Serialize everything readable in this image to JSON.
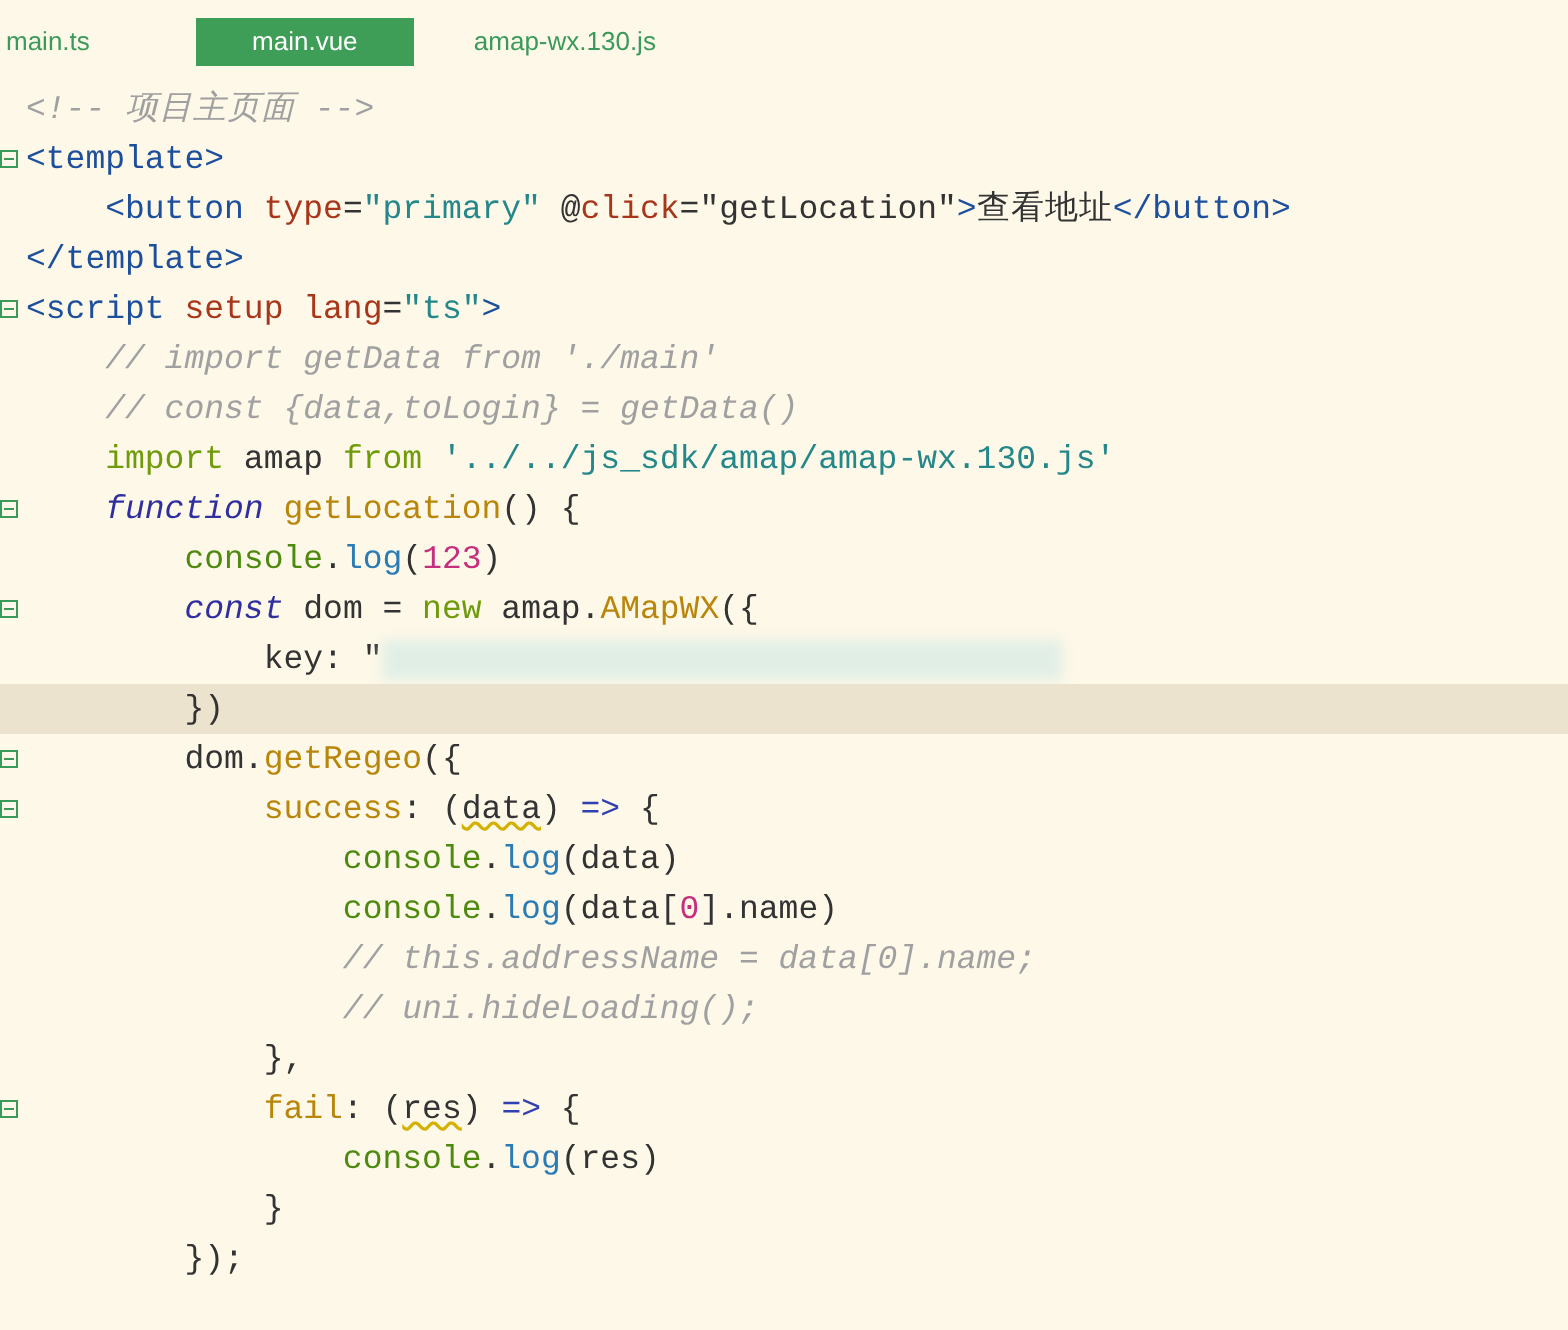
{
  "tabs": [
    {
      "label": "main.ts",
      "selected": false
    },
    {
      "label": "main.vue",
      "selected": true
    },
    {
      "label": "amap-wx.130.js",
      "selected": false
    }
  ],
  "editor": {
    "lines": [
      {
        "tokens": [
          {
            "kind": "comment",
            "text": "<!-- 项目主页面 -->"
          }
        ]
      },
      {
        "fold": true,
        "tokens": [
          {
            "kind": "tag",
            "text": "<template>"
          }
        ]
      },
      {
        "tokens": [
          {
            "kind": "tag",
            "text": "    <button "
          },
          {
            "kind": "attr",
            "text": "type"
          },
          {
            "kind": "plain",
            "text": "="
          },
          {
            "kind": "string",
            "text": "\"primary\""
          },
          {
            "kind": "plain",
            "text": " @"
          },
          {
            "kind": "attr",
            "text": "click"
          },
          {
            "kind": "plain",
            "text": "=\"getLocation\""
          },
          {
            "kind": "tag",
            "text": ">"
          },
          {
            "kind": "plain",
            "text": "查看地址"
          },
          {
            "kind": "tag",
            "text": "</button>"
          }
        ]
      },
      {
        "tokens": [
          {
            "kind": "tag",
            "text": "</template>"
          }
        ]
      },
      {
        "fold": true,
        "tokens": [
          {
            "kind": "tag",
            "text": "<script "
          },
          {
            "kind": "attr",
            "text": "setup lang"
          },
          {
            "kind": "plain",
            "text": "="
          },
          {
            "kind": "string",
            "text": "\"ts\""
          },
          {
            "kind": "tag",
            "text": ">"
          }
        ]
      },
      {
        "tokens": [
          {
            "kind": "comment",
            "text": "    // import getData from './main'"
          }
        ]
      },
      {
        "tokens": [
          {
            "kind": "comment",
            "text": "    // const {data,toLogin} = getData()"
          }
        ]
      },
      {
        "tokens": [
          {
            "kind": "keyword",
            "text": "    import"
          },
          {
            "kind": "plain",
            "text": " amap "
          },
          {
            "kind": "keyword",
            "text": "from "
          },
          {
            "kind": "string",
            "text": "'../../js_sdk/amap/amap-wx.130.js'"
          }
        ]
      },
      {
        "fold": true,
        "tokens": [
          {
            "kind": "storage",
            "text": "    function "
          },
          {
            "kind": "function",
            "text": "getLocation"
          },
          {
            "kind": "plain",
            "text": "() {"
          }
        ]
      },
      {
        "tokens": [
          {
            "kind": "object",
            "text": "        console"
          },
          {
            "kind": "plain",
            "text": "."
          },
          {
            "kind": "method",
            "text": "log"
          },
          {
            "kind": "plain",
            "text": "("
          },
          {
            "kind": "number",
            "text": "123"
          },
          {
            "kind": "plain",
            "text": ")"
          }
        ]
      },
      {
        "fold": true,
        "tokens": [
          {
            "kind": "storage",
            "text": "        const"
          },
          {
            "kind": "plain",
            "text": " dom = "
          },
          {
            "kind": "keyword",
            "text": "new"
          },
          {
            "kind": "plain",
            "text": " amap."
          },
          {
            "kind": "function",
            "text": "AMapWX"
          },
          {
            "kind": "plain",
            "text": "({"
          }
        ]
      },
      {
        "redacted": true,
        "tokens": [
          {
            "kind": "plain",
            "text": "            key: \""
          }
        ]
      },
      {
        "highlighted": true,
        "tokens": [
          {
            "kind": "plain",
            "text": "        })"
          }
        ]
      },
      {
        "fold": true,
        "tokens": [
          {
            "kind": "plain",
            "text": "        dom."
          },
          {
            "kind": "function",
            "text": "getRegeo"
          },
          {
            "kind": "plain",
            "text": "({"
          }
        ]
      },
      {
        "fold": true,
        "tokens": [
          {
            "kind": "function",
            "text": "            success"
          },
          {
            "kind": "plain",
            "text": ": ("
          },
          {
            "kind": "warned",
            "text": "data"
          },
          {
            "kind": "plain",
            "text": ") "
          },
          {
            "kind": "operator",
            "text": "=>"
          },
          {
            "kind": "plain",
            "text": " {"
          }
        ]
      },
      {
        "tokens": [
          {
            "kind": "object",
            "text": "                console"
          },
          {
            "kind": "plain",
            "text": "."
          },
          {
            "kind": "method",
            "text": "log"
          },
          {
            "kind": "plain",
            "text": "(data)"
          }
        ]
      },
      {
        "tokens": [
          {
            "kind": "object",
            "text": "                console"
          },
          {
            "kind": "plain",
            "text": "."
          },
          {
            "kind": "method",
            "text": "log"
          },
          {
            "kind": "plain",
            "text": "(data["
          },
          {
            "kind": "number",
            "text": "0"
          },
          {
            "kind": "plain",
            "text": "].name)"
          }
        ]
      },
      {
        "tokens": [
          {
            "kind": "comment",
            "text": "                // this.addressName = data[0].name;"
          }
        ]
      },
      {
        "tokens": [
          {
            "kind": "comment",
            "text": "                // uni.hideLoading();"
          }
        ]
      },
      {
        "tokens": [
          {
            "kind": "plain",
            "text": "            },"
          }
        ]
      },
      {
        "fold": true,
        "tokens": [
          {
            "kind": "function",
            "text": "            fail"
          },
          {
            "kind": "plain",
            "text": ": ("
          },
          {
            "kind": "warned",
            "text": "res"
          },
          {
            "kind": "plain",
            "text": ") "
          },
          {
            "kind": "operator",
            "text": "=>"
          },
          {
            "kind": "plain",
            "text": " {"
          }
        ]
      },
      {
        "tokens": [
          {
            "kind": "object",
            "text": "                console"
          },
          {
            "kind": "plain",
            "text": "."
          },
          {
            "kind": "method",
            "text": "log"
          },
          {
            "kind": "plain",
            "text": "(res)"
          }
        ]
      },
      {
        "tokens": [
          {
            "kind": "plain",
            "text": "            }"
          }
        ]
      },
      {
        "tokens": [
          {
            "kind": "plain",
            "text": "        });"
          }
        ]
      }
    ]
  }
}
